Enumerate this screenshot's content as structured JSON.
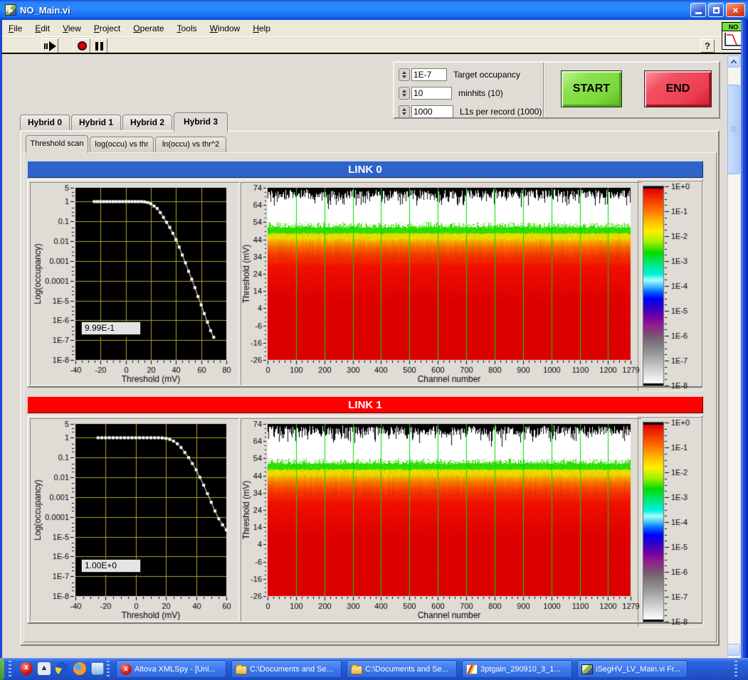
{
  "window": {
    "title": "NO_Main.vi"
  },
  "menu": {
    "items": [
      "File",
      "Edit",
      "View",
      "Project",
      "Operate",
      "Tools",
      "Window",
      "Help"
    ]
  },
  "toolbar": {
    "run_icon": "run-arrow-icon",
    "stop_icon": "stop-icon",
    "pause_icon": "pause-icon",
    "help_label": "?"
  },
  "vi_icon": {
    "label": "NO"
  },
  "controls": {
    "fields": [
      {
        "value": "1E-7",
        "label": "Target occupancy"
      },
      {
        "value": "10",
        "label": "minhits (10)"
      },
      {
        "value": "1000",
        "label": "L1s per record (1000)"
      }
    ],
    "start_label": "START",
    "end_label": "END"
  },
  "tabs": {
    "hybrids": [
      "Hybrid 0",
      "Hybrid 1",
      "Hybrid 2",
      "Hybrid 3"
    ],
    "selected_hybrid": "Hybrid 3",
    "subtabs": [
      "Threshold scan",
      "log(occu) vs thr",
      "ln(occu) vs thr^2"
    ],
    "selected_subtab": "Threshold scan"
  },
  "links": [
    {
      "title": "LINK 0",
      "header_color": "#2E64C8",
      "cursor_value": "9.99E-1"
    },
    {
      "title": "LINK 1",
      "header_color": "#FF0000",
      "cursor_value": "1.00E+0"
    }
  ],
  "chart_data": [
    {
      "id": "link0-scan",
      "type": "line",
      "link": "LINK 0",
      "xlabel": "Threshold (mV)",
      "ylabel": "Log(occupancy)",
      "xlim": [
        -40,
        80
      ],
      "ylim": [
        1e-08,
        5
      ],
      "xticks": [
        -40,
        -20,
        0,
        20,
        40,
        60,
        80
      ],
      "xgrid": [
        -20,
        0,
        20,
        40,
        60
      ],
      "ytick_labels": [
        "5",
        "1",
        "0.1",
        "0.01",
        "0.001",
        "0.0001",
        "1E-5",
        "1E-6",
        "1E-7",
        "1E-8"
      ],
      "ytick_values": [
        5,
        1,
        0.1,
        0.01,
        0.001,
        0.0001,
        1e-05,
        1e-06,
        1e-07,
        1e-08
      ],
      "grid": true,
      "grid_color": "#B0A428",
      "bg": "#000000",
      "point_color": "#FFFFFF",
      "x": [
        -25,
        -22.5,
        -20,
        -17.5,
        -15,
        -12.5,
        -10,
        -7.5,
        -5,
        -2.5,
        0,
        2.5,
        5,
        7.5,
        10,
        12.5,
        15,
        17.5,
        20,
        22.5,
        25,
        27.5,
        30,
        32.5,
        35,
        37.5,
        40,
        42.5,
        45,
        47.5,
        50,
        52.5,
        55,
        57.5,
        60,
        62.5,
        65,
        67.5,
        70
      ],
      "y": [
        1,
        1,
        1,
        1,
        1,
        1,
        1,
        1,
        1,
        1,
        1,
        1,
        1,
        1,
        1,
        1,
        0.97,
        0.9,
        0.78,
        0.6,
        0.45,
        0.28,
        0.16,
        0.09,
        0.05,
        0.025,
        0.012,
        0.005,
        0.002,
        0.0008,
        0.0003,
        0.00012,
        4.5e-05,
        1.6e-05,
        6e-06,
        2.2e-06,
        8e-07,
        3e-07,
        1.4e-07
      ],
      "cursor_value": "9.99E-1"
    },
    {
      "id": "link0-map",
      "type": "heatmap",
      "link": "LINK 0",
      "xlabel": "Channel number",
      "ylabel": "Threshold (mV)",
      "xlim": [
        0,
        1279
      ],
      "ylim": [
        -26,
        74
      ],
      "xticks": [
        0,
        100,
        200,
        300,
        400,
        500,
        600,
        700,
        800,
        900,
        1000,
        1100,
        1200,
        1279
      ],
      "yticks": [
        74,
        64,
        54,
        44,
        34,
        24,
        14,
        4,
        -6,
        -16,
        -26
      ],
      "grid_color": "#00DC00",
      "seed": 7,
      "bands": {
        "bars": {
          "from": 74,
          "color": "#000000",
          "bg": "#FFFFFF",
          "note": "black dropout bars hanging from top edge"
        },
        "white_to": 54,
        "green": {
          "speckle_top": 54,
          "top": 50.6,
          "bottom": 47.5,
          "color": "#2CDE00",
          "occupancy": "~1E-3"
        },
        "yellow": {
          "bottom": 44,
          "color": "#F0E400",
          "occupancy": "~1E-2"
        },
        "orange": {
          "bottom": 36,
          "color": "#FF7A00",
          "occupancy": "~1E-1"
        },
        "red": {
          "color": "#DF0000",
          "occupancy": "~1E+0"
        }
      }
    },
    {
      "id": "link0-colorbar",
      "type": "colorbar",
      "tick_labels": [
        "1E+0",
        "1E-1",
        "1E-2",
        "1E-3",
        "1E-4",
        "1E-5",
        "1E-6",
        "1E-7",
        "1E-8"
      ],
      "stops": [
        [
          0,
          "#E00000"
        ],
        [
          0.05,
          "#F23000"
        ],
        [
          0.11,
          "#FF7000"
        ],
        [
          0.165,
          "#FFB400"
        ],
        [
          0.22,
          "#FFF000"
        ],
        [
          0.275,
          "#A0F000"
        ],
        [
          0.33,
          "#00DC00"
        ],
        [
          0.385,
          "#00E878"
        ],
        [
          0.44,
          "#00F0E0"
        ],
        [
          0.47,
          "#A8FFF6"
        ],
        [
          0.5,
          "#48C0FF"
        ],
        [
          0.53,
          "#0068FF"
        ],
        [
          0.565,
          "#0000FF"
        ],
        [
          0.61,
          "#2E00C8"
        ],
        [
          0.66,
          "#7400A4"
        ],
        [
          0.7,
          "#8F1F8F"
        ],
        [
          0.75,
          "#7E4E74"
        ],
        [
          0.79,
          "#7A747A"
        ],
        [
          0.84,
          "#949494"
        ],
        [
          0.91,
          "#C4C4C4"
        ],
        [
          1,
          "#FFFFFF"
        ]
      ]
    },
    {
      "id": "link1-scan",
      "type": "line",
      "link": "LINK 1",
      "xlabel": "Threshold (mV)",
      "ylabel": "Log(occupancy)",
      "xlim": [
        -40,
        60
      ],
      "ylim": [
        1e-08,
        5
      ],
      "xticks": [
        -40,
        -20,
        0,
        20,
        40,
        60
      ],
      "xgrid": [
        -20,
        0,
        20,
        40
      ],
      "ytick_labels": [
        "5",
        "1",
        "0.1",
        "0.01",
        "0.001",
        "0.0001",
        "1E-5",
        "1E-6",
        "1E-7",
        "1E-8"
      ],
      "ytick_values": [
        5,
        1,
        0.1,
        0.01,
        0.001,
        0.0001,
        1e-05,
        1e-06,
        1e-07,
        1e-08
      ],
      "grid": true,
      "grid_color": "#B0A428",
      "bg": "#000000",
      "point_color": "#FFFFFF",
      "x": [
        -25,
        -22.5,
        -20,
        -17.5,
        -15,
        -12.5,
        -10,
        -7.5,
        -5,
        -2.5,
        0,
        2.5,
        5,
        7.5,
        10,
        12.5,
        15,
        17.5,
        20,
        22.5,
        25,
        27.5,
        30,
        32.5,
        35,
        37.5,
        40,
        42.5,
        45,
        47.5,
        50,
        52.5,
        55,
        57.5,
        60
      ],
      "y": [
        1,
        1,
        1,
        1,
        1,
        1,
        1,
        1,
        1,
        1,
        1,
        1,
        1,
        1,
        1,
        1,
        1,
        0.98,
        0.93,
        0.83,
        0.68,
        0.5,
        0.32,
        0.18,
        0.1,
        0.05,
        0.024,
        0.01,
        0.004,
        0.0015,
        0.00055,
        0.0002,
        8e-05,
        4e-05,
        2.2e-05
      ],
      "cursor_value": "1.00E+0"
    },
    {
      "id": "link1-map",
      "type": "heatmap",
      "link": "LINK 1",
      "xlabel": "Channel number",
      "ylabel": "Threshold (mV)",
      "xlim": [
        0,
        1279
      ],
      "ylim": [
        -26,
        74
      ],
      "xticks": [
        0,
        100,
        200,
        300,
        400,
        500,
        600,
        700,
        800,
        900,
        1000,
        1100,
        1200,
        1279
      ],
      "yticks": [
        74,
        64,
        54,
        44,
        34,
        24,
        14,
        4,
        -6,
        -16,
        -26
      ],
      "grid_color": "#00DC00",
      "seed": 13,
      "bands": {
        "bars": {
          "from": 74,
          "color": "#000000",
          "bg": "#FFFFFF",
          "note": "black dropout bars hanging from top edge"
        },
        "white_to": 54,
        "green": {
          "speckle_top": 54,
          "top": 50.6,
          "bottom": 47.5,
          "color": "#2CDE00",
          "occupancy": "~1E-3"
        },
        "yellow": {
          "bottom": 44,
          "color": "#F0E400",
          "occupancy": "~1E-2"
        },
        "orange": {
          "bottom": 36,
          "color": "#FF7A00",
          "occupancy": "~1E-1"
        },
        "red": {
          "color": "#DF0000",
          "occupancy": "~1E+0"
        }
      }
    },
    {
      "id": "link1-colorbar",
      "type": "colorbar",
      "tick_labels": [
        "1E+0",
        "1E-1",
        "1E-2",
        "1E-3",
        "1E-4",
        "1E-5",
        "1E-6",
        "1E-7",
        "1E-8"
      ],
      "stops": [
        [
          0,
          "#E00000"
        ],
        [
          0.05,
          "#F23000"
        ],
        [
          0.11,
          "#FF7000"
        ],
        [
          0.165,
          "#FFB400"
        ],
        [
          0.22,
          "#FFF000"
        ],
        [
          0.275,
          "#A0F000"
        ],
        [
          0.33,
          "#00DC00"
        ],
        [
          0.385,
          "#00E878"
        ],
        [
          0.44,
          "#00F0E0"
        ],
        [
          0.47,
          "#A8FFF6"
        ],
        [
          0.5,
          "#48C0FF"
        ],
        [
          0.53,
          "#0068FF"
        ],
        [
          0.565,
          "#0000FF"
        ],
        [
          0.61,
          "#2E00C8"
        ],
        [
          0.66,
          "#7400A4"
        ],
        [
          0.7,
          "#8F1F8F"
        ],
        [
          0.75,
          "#7E4E74"
        ],
        [
          0.79,
          "#7A747A"
        ],
        [
          0.84,
          "#949494"
        ],
        [
          0.91,
          "#C4C4C4"
        ],
        [
          1,
          "#FFFFFF"
        ]
      ]
    }
  ],
  "taskbar": {
    "quick_launch": [
      "xmlspy-icon",
      "prism-icon",
      "globe-icon",
      "firefox-icon",
      "glass-icon"
    ],
    "buttons": [
      {
        "icon": "xmlspy-icon",
        "label": "Altova XMLSpy - [Uni..."
      },
      {
        "icon": "folder-icon",
        "label": "C:\\Documents and Se..."
      },
      {
        "icon": "folder-icon",
        "label": "C:\\Documents and Se..."
      },
      {
        "icon": "plot-icon",
        "label": "3ptgain_290910_3_1..."
      },
      {
        "icon": "labview-icon",
        "label": "iSegHV_LV_Main.vi Fr..."
      }
    ]
  }
}
